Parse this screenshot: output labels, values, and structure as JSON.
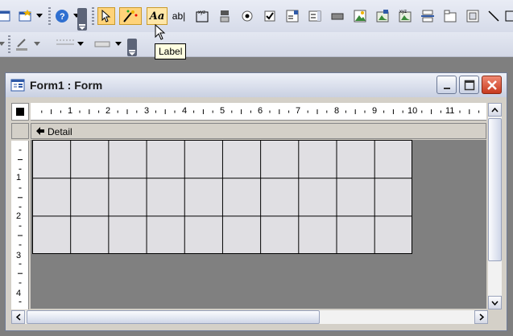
{
  "tooltip": {
    "text": "Label"
  },
  "window": {
    "title": "Form1 : Form"
  },
  "section": {
    "label": "Detail"
  },
  "ruler": {
    "h_numbers": [
      "1",
      "2",
      "3",
      "4",
      "5",
      "6",
      "7",
      "8",
      "9",
      "10",
      "11"
    ],
    "v_numbers": [
      "1",
      "2",
      "3",
      "4"
    ]
  },
  "toolbox": {
    "label_tool_glyph": "Aa",
    "textbox_tool_glyph": "ab|"
  },
  "colors": {
    "selected_tool": "#ffd37a",
    "close_button": "#c7391d",
    "design_background": "#808080"
  }
}
